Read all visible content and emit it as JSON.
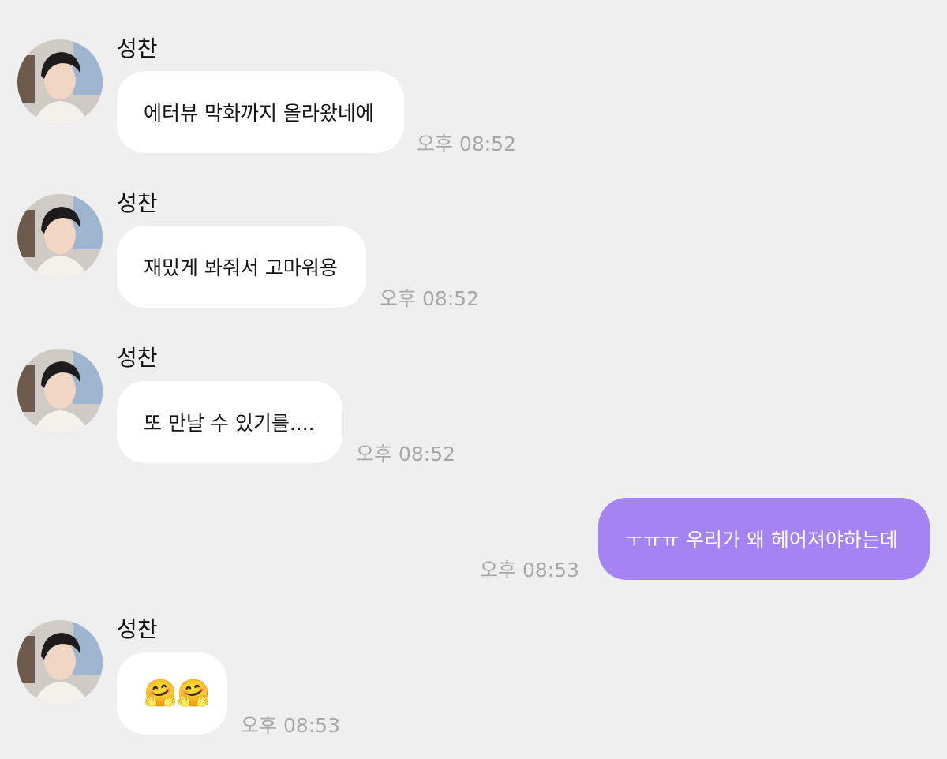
{
  "messages": [
    {
      "sender": "성찬",
      "text": "에터뷰 막화까지 올라왔네에",
      "time": "오후 08:52",
      "mine": false
    },
    {
      "sender": "성찬",
      "text": "재밌게 봐줘서 고마워용",
      "time": "오후 08:52",
      "mine": false
    },
    {
      "sender": "성찬",
      "text": "또 만날 수 있기를....",
      "time": "오후 08:52",
      "mine": false
    },
    {
      "sender": "",
      "text": "ㅜㅠㅠ 우리가 왜 헤어져야하는데",
      "time": "오후 08:53",
      "mine": true
    },
    {
      "sender": "성찬",
      "text": "🤗🤗",
      "time": "오후 08:53",
      "mine": false
    }
  ],
  "colors": {
    "background": "#efefef",
    "incoming_bubble": "#ffffff",
    "outgoing_bubble": "#a384f1",
    "timestamp": "#a7a7a7"
  },
  "icons": {
    "avatar": "profile-photo-avatar"
  }
}
